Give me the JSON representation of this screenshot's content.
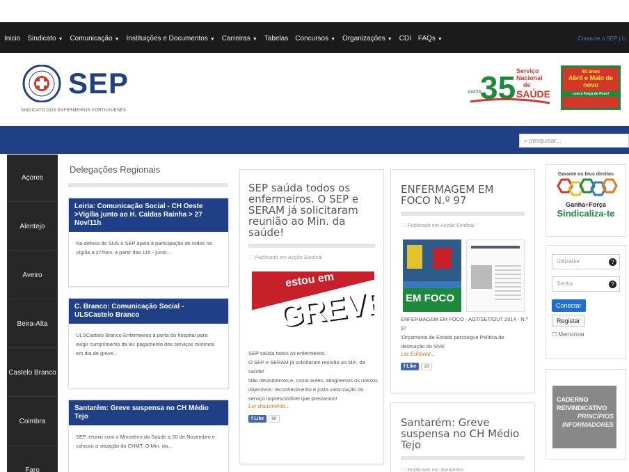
{
  "nav": {
    "items": [
      "Inicio",
      "Sindicato",
      "Comunicação",
      "Instituições e Documentos",
      "Carreiras",
      "Tabelas",
      "Concursos",
      "Organizações",
      "CDI",
      "FAQs"
    ],
    "right": "Contacte o SEP | Li"
  },
  "header": {
    "logo": "SEP",
    "logo_sub": "SINDICATO DOS ENFERMEIROS PORTUGUESES",
    "banner35_anos": "ANOS",
    "banner35_num": "35",
    "banner35_text": [
      "Serviço",
      "Nacional",
      "de",
      "SAÚDE"
    ],
    "banner40": {
      "a": "40 anos",
      "b": "Abril e Maio de novo",
      "c": "com a Força do Povo!"
    }
  },
  "search": {
    "placeholder": "pesquisar..."
  },
  "sidebar": {
    "items": [
      "Açores",
      "Alentejo",
      "Aveiro",
      "Beira-Alta",
      "Castelo Branco",
      "Coimbra",
      "Faro"
    ]
  },
  "deleg": {
    "title": "Delegações Regionais",
    "cards": [
      {
        "title": "Leiria: Comunicação Social - CH Oeste >Vigília junto ao H. Caldas Rainha > 27 Nov/11h",
        "body": "Na defesa do SNS o SEP apela à participação de todos na Vigília a 27/Nov. a partir das 11h - junto..."
      },
      {
        "title": "C. Branco: Comunicação Social - ULSCastelo Branco",
        "body": "ULSCastelo Branco Enfermeiros à porta do hospital para exigir cumprimento da lei: pagamento dos serviços mínimos em dia de greve..."
      },
      {
        "title": "Santarém: Greve suspensa no CH Médio Tejo",
        "body": "SEP, reuniu com o Ministério da Saúde a 20 de Novembro e colocou a situação do CHMT. O Min. da..."
      }
    ]
  },
  "post1": {
    "title": "SEP saúda todos os enfermeiros. O SEP e SERAM já solicitaram reunião ao Min. da saúde!",
    "pub": "Publicado em Acção Sindical",
    "image_text": [
      "estou",
      "em",
      "GREVE"
    ],
    "body": [
      "SEP saúda todos os enfermeiros.",
      "O SEP e SERAM já solicitaram reunião ao Min. da saúde!",
      "Não desistiremos e, como antes, atingiremos os nossos objectivos: reconhecimento e justa valorização do serviço imprescindível que prestamos!"
    ],
    "more": "Ler documento...",
    "like": "Like",
    "count": "80"
  },
  "post2": {
    "title": "ENFERMAGEM EM FOCO N.º 97",
    "pub": "Publicado em Acção Sindical",
    "image_text": "EM FOCO",
    "body": [
      "ENFERMAGEM EM FOCO - AGT/SET/OUT 2014 - N.º 97",
      "'Orçamento de Estado porssegue Política de destruição do SNS'"
    ],
    "more": "Ler Editorial...",
    "like": "Like",
    "count": "18"
  },
  "post3": {
    "title": "Santarém: Greve suspensa no CH Médio Tejo",
    "pub": "Publicado em Santarém"
  },
  "right": {
    "promo": {
      "a": "Garante os teus direitos",
      "b": "Ganha",
      "c": "Força",
      "d": "Sindicaliza-te"
    },
    "login": {
      "user": "Utilizador",
      "pass": "Senha",
      "login": "Conectar",
      "register": "Registar",
      "remember": "Memorizar"
    },
    "caderno": [
      "CADERNO",
      "REIVINDICATIVO",
      "PRINCÍPIOS",
      "INFORMADORES"
    ]
  },
  "colors": {
    "navy": "#1f3f87",
    "dark": "#1b1b1b",
    "orange": "#e07a1a"
  }
}
